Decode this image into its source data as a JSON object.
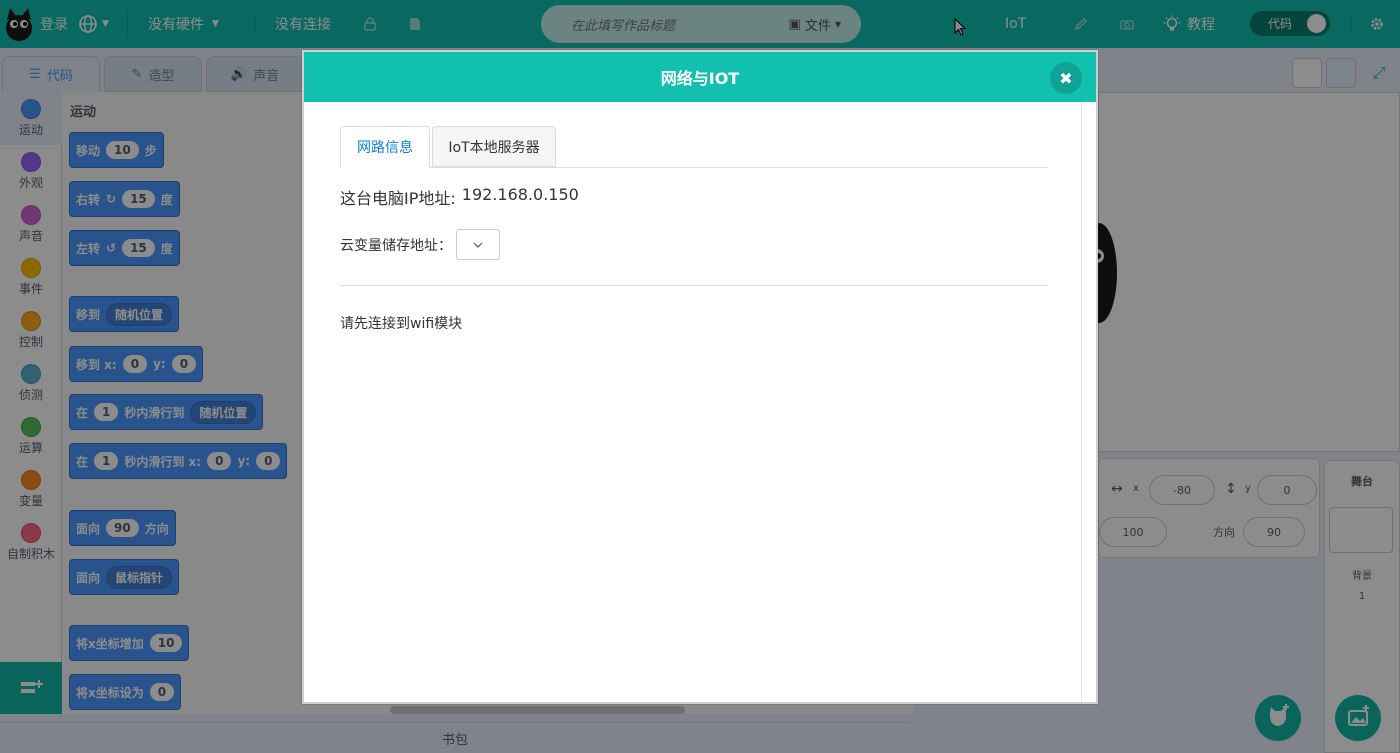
{
  "menubar": {
    "login": "登录",
    "hardware": "没有硬件",
    "connection": "没有连接",
    "title_placeholder": "在此填写作品标题",
    "file": "文件",
    "iot": "IoT",
    "tutorial": "教程",
    "code_toggle": "代码"
  },
  "tabs": {
    "code": "代码",
    "costumes": "造型",
    "sounds": "声音"
  },
  "categories": [
    {
      "label": "运动",
      "color": "#4c97ff"
    },
    {
      "label": "外观",
      "color": "#9966ff"
    },
    {
      "label": "声音",
      "color": "#cf63cf"
    },
    {
      "label": "事件",
      "color": "#ffbf00"
    },
    {
      "label": "控制",
      "color": "#ffab19"
    },
    {
      "label": "侦测",
      "color": "#5cb1d6"
    },
    {
      "label": "运算",
      "color": "#59c059"
    },
    {
      "label": "变量",
      "color": "#ff8c1a"
    },
    {
      "label": "自制积木",
      "color": "#ff6680"
    }
  ],
  "palette": {
    "title": "运动",
    "move": "移动",
    "steps_val": "10",
    "steps": "步",
    "turn_right": "右转",
    "turn_right_val": "15",
    "degrees": "度",
    "turn_left": "左转",
    "turn_left_val": "15",
    "goto": "移到",
    "random_pos": "随机位置",
    "goto_xy": "移到 x:",
    "x0": "0",
    "y_label": "y:",
    "y0": "0",
    "glide_in": "在",
    "glide_secs": "1",
    "glide_to": "秒内滑行到",
    "glide_random": "随机位置",
    "glide_to_xy": "秒内滑行到 x:",
    "point_dir": "面向",
    "dir_val": "90",
    "direction": "方向",
    "point_towards": "面向",
    "mouse_pointer": "鼠标指针",
    "change_x": "将x坐标增加",
    "change_x_val": "10",
    "set_x": "将x坐标设为",
    "set_x_val": "0"
  },
  "backpack": "书包",
  "sprite": {
    "x_label": "x",
    "x_val": "-80",
    "y_label": "y",
    "y_val": "0",
    "size_val": "100",
    "dir_label": "方向",
    "dir_val": "90"
  },
  "stage_panel": {
    "title": "舞台",
    "backdrops": "背景",
    "backdrop_count": "1"
  },
  "modal": {
    "title": "网络与IOT",
    "tab_network": "网路信息",
    "tab_iot_server": "IoT本地服务器",
    "ip_label": "这台电脑IP地址:",
    "ip_value": "192.168.0.150",
    "cloud_label": "云变量储存地址：",
    "wifi_msg": "请先连接到wifi模块"
  }
}
